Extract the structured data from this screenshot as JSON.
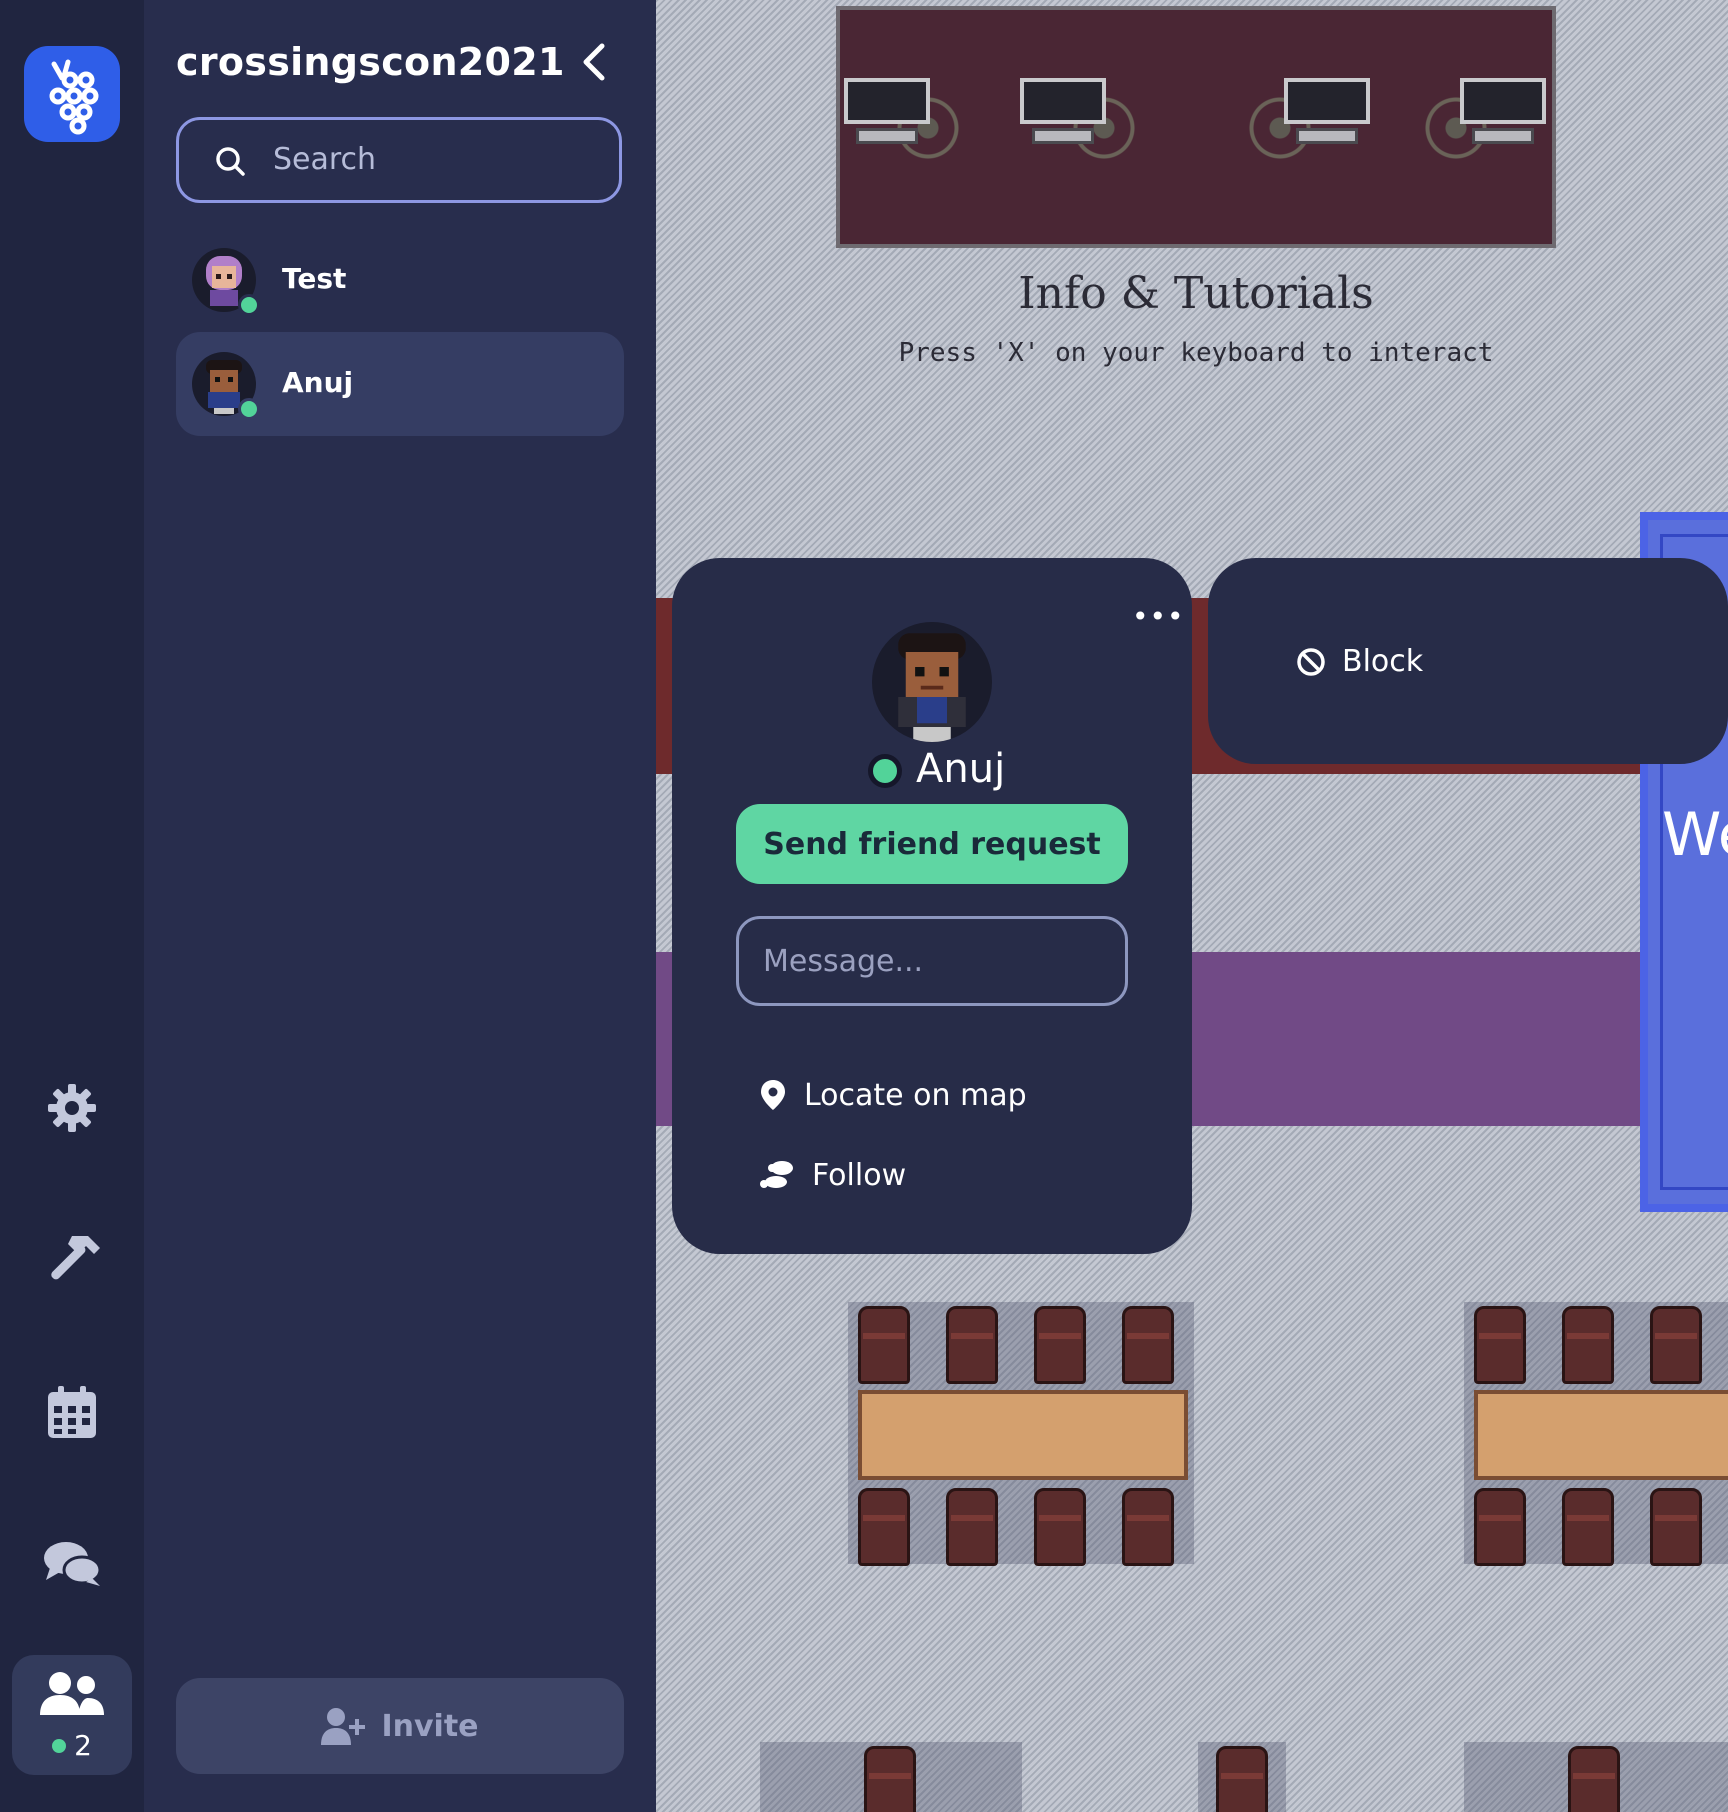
{
  "space": {
    "name": "crossingscon2021"
  },
  "search": {
    "placeholder": "Search"
  },
  "members": [
    {
      "name": "Test",
      "online": true
    },
    {
      "name": "Anuj",
      "online": true,
      "selected": true
    }
  ],
  "rail": {
    "people_count": "2",
    "icons": [
      "grapes-logo-icon",
      "gear-icon",
      "hammer-icon",
      "calendar-icon",
      "chat-bubbles-icon",
      "people-icon"
    ]
  },
  "invite": {
    "label": "Invite"
  },
  "map": {
    "sign_title": "Info & Tutorials",
    "sign_subtitle": "Press 'X' on your keyboard to interact",
    "board_text": "We"
  },
  "profile_card": {
    "name": "Anuj",
    "status": "online",
    "friend_button": "Send friend request",
    "message_placeholder": "Message...",
    "actions": [
      {
        "label": "Locate on map",
        "icon": "map-pin-icon"
      },
      {
        "label": "Follow",
        "icon": "footsteps-icon"
      }
    ],
    "more_label": "•••"
  },
  "more_menu": {
    "block_label": "Block",
    "icon": "block-icon"
  },
  "colors": {
    "accent_green": "#5fd6a3",
    "online": "#52d399",
    "brand_blue": "#2f5ee8",
    "panel": "#282d4d"
  }
}
